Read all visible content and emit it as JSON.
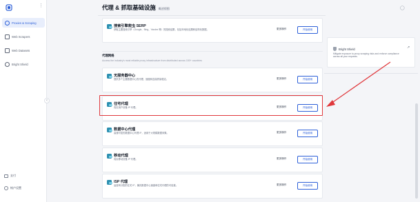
{
  "sidebar": {
    "items": [
      {
        "label": "Proxies & Scraping",
        "icon": "globe-icon",
        "active": true
      },
      {
        "label": "Web Scrapers",
        "icon": "scraper-icon",
        "active": false
      },
      {
        "label": "Web Datasets",
        "icon": "dataset-icon",
        "active": false
      },
      {
        "label": "Bright Shield",
        "icon": "shield-icon",
        "active": false
      }
    ],
    "bottom": [
      {
        "label": "支付",
        "icon": "card-icon"
      },
      {
        "label": "帐户设置",
        "icon": "settings-icon"
      }
    ]
  },
  "header": {
    "title": "代理 & 抓取基础设施",
    "subtitle": "概述视图"
  },
  "cards_top": [
    {
      "title": "搜索引擎爬虫 SERP",
      "desc": "获取主要搜索引擎（Google、Bing、Yandex 等）的搜索结果，包括本地化结果和结构化数据。"
    }
  ],
  "section": {
    "title": "代理网络",
    "desc": "Access the industry's most reliable proxy infrastructure from distributed across 150+ countries"
  },
  "cards": [
    {
      "title": "无服务器中心",
      "desc": "提供多个主要数据中心的代理，速度和连接质量稳定。"
    },
    {
      "title": "住宅代理",
      "desc": "真实用户设备 IP 代理。"
    },
    {
      "title": "数据中心代理",
      "desc": "高速可靠的数据中心代理 IP，适用于大规模数据采集。"
    },
    {
      "title": "移动代理",
      "desc": "真实移动设备 IP 代理。"
    },
    {
      "title": "ISP 代理",
      "desc": "运营商分配的住宅 IP，兼具数据中心速度和住宅代理的可信度。"
    }
  ],
  "buttons": {
    "more": "更多操作",
    "start": "开始使用"
  },
  "right_panel": {
    "title": "Bright Shield",
    "desc": "Mitigate exposure to proxy scraping risks and enforce compliance across all your requests.",
    "link_icon": "external-link-icon"
  },
  "colors": {
    "accent": "#2c5fd8",
    "highlight": "#e0383c"
  }
}
